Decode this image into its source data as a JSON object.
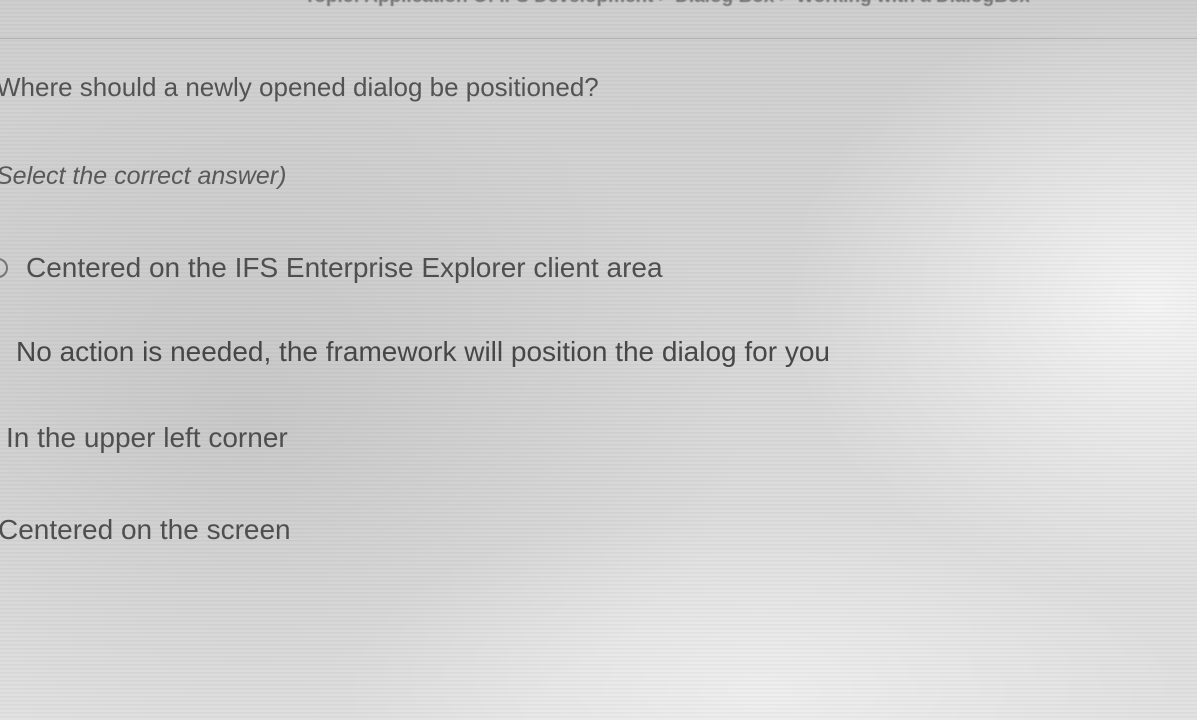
{
  "header": {
    "topic_text": "Topic: Application Of IFS Development > Dialog Box > Working with a DialogBox"
  },
  "question": {
    "text": "Where should a newly opened dialog be positioned?",
    "instruction": "Select the correct answer)"
  },
  "options": [
    {
      "label": "Centered on the IFS Enterprise Explorer client area"
    },
    {
      "label": "No action is needed, the framework will position the dialog for you"
    },
    {
      "label": "In the upper left corner"
    },
    {
      "label": "Centered on the screen"
    }
  ],
  "colors": {
    "text": "#505050",
    "background": "#d6d6d6"
  }
}
